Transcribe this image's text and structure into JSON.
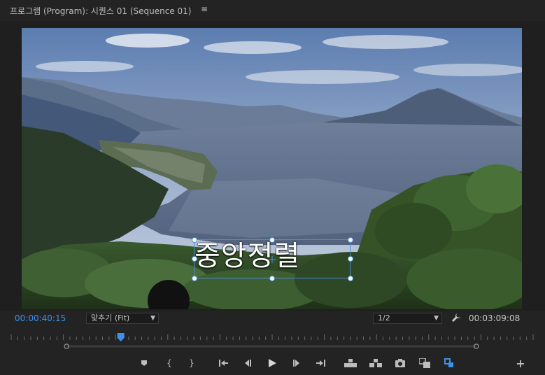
{
  "panel": {
    "title": "프로그램 (Program): 시퀀스 01 (Sequence 01)",
    "menu_icon": "hamburger-icon"
  },
  "overlay": {
    "title_text": "중앙정렬"
  },
  "footer": {
    "current_time": "00:00:40:15",
    "zoom_label": "맞추기 (Fit)",
    "resolution_label": "1/2",
    "duration": "00:03:09:08"
  },
  "playhead": {
    "position_fraction": 0.21
  },
  "controls": [
    "add-marker-icon",
    "mark-in-icon",
    "mark-out-icon",
    "go-to-in-icon",
    "step-back-icon",
    "play-icon",
    "step-forward-icon",
    "go-to-out-icon",
    "lift-icon",
    "extract-icon",
    "export-frame-icon",
    "comparison-view-icon",
    "loop-icon",
    "button-editor-icon"
  ],
  "colors": {
    "accent": "#3d91e6",
    "panel_bg": "#232323"
  }
}
